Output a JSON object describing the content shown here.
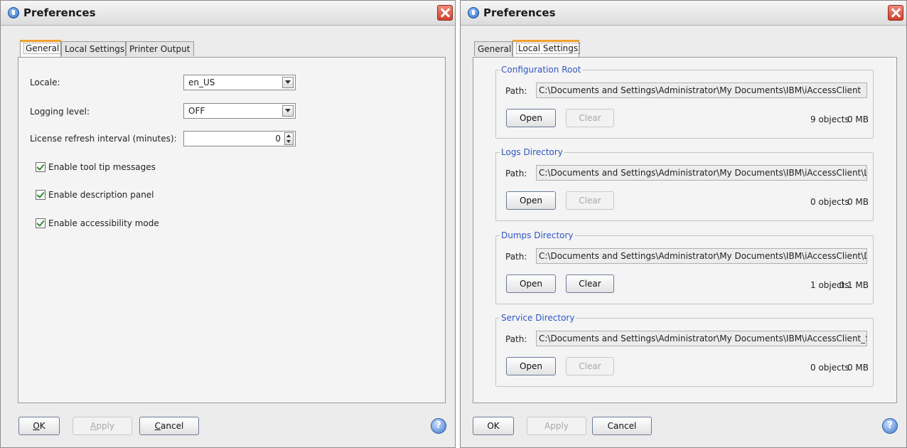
{
  "left": {
    "title": "Preferences",
    "tabs": [
      "General",
      "Local Settings",
      "Printer Output"
    ],
    "locale_label": "Locale:",
    "locale_value": "en_US",
    "logging_label": "Logging level:",
    "logging_value": "OFF",
    "license_label": "License refresh interval (minutes):",
    "license_value": "0",
    "checks": [
      "Enable tool tip messages",
      "Enable description panel",
      "Enable accessibility mode"
    ],
    "buttons": {
      "ok_first": "O",
      "ok_rest": "K",
      "apply_first": "A",
      "apply_rest": "pply",
      "cancel_first": "C",
      "cancel_rest": "ancel"
    },
    "help_glyph": "?"
  },
  "right": {
    "title": "Preferences",
    "tabs": [
      "General",
      "Local Settings"
    ],
    "groups": [
      {
        "title": "Configuration Root",
        "path_label": "Path:",
        "path": "C:\\Documents and Settings\\Administrator\\My Documents\\IBM\\iAccessClient",
        "open": "Open",
        "clear": "Clear",
        "clear_enabled": false,
        "objects": "9 objects",
        "size": "0 MB"
      },
      {
        "title": "Logs Directory",
        "path_label": "Path:",
        "path": "C:\\Documents and Settings\\Administrator\\My Documents\\IBM\\iAccessClient\\Logs",
        "open": "Open",
        "clear": "Clear",
        "clear_enabled": false,
        "objects": "0 objects",
        "size": "0 MB"
      },
      {
        "title": "Dumps Directory",
        "path_label": "Path:",
        "path": "C:\\Documents and Settings\\Administrator\\My Documents\\IBM\\iAccessClient\\Dumps",
        "open": "Open",
        "clear": "Clear",
        "clear_enabled": true,
        "objects": "1 objects",
        "size": "0.1 MB"
      },
      {
        "title": "Service Directory",
        "path_label": "Path:",
        "path": "C:\\Documents and Settings\\Administrator\\My Documents\\IBM\\iAccessClient_Service",
        "open": "Open",
        "clear": "Clear",
        "clear_enabled": false,
        "objects": "0 objects",
        "size": "0 MB"
      }
    ],
    "buttons": {
      "ok": "OK",
      "apply": "Apply",
      "cancel": "Cancel"
    },
    "help_glyph": "?"
  },
  "icons": {
    "app": "app-icon",
    "close": "close-icon",
    "help": "help-icon",
    "dropdown": "chevron-down-icon",
    "spinner": "spinner-icon",
    "check": "checkmark-icon"
  },
  "colors": {
    "group_title": "#2f55c4",
    "active_tab_accent": "#f0a030",
    "close_button": "#d0402e",
    "disabled_text": "#a8a8a8"
  }
}
